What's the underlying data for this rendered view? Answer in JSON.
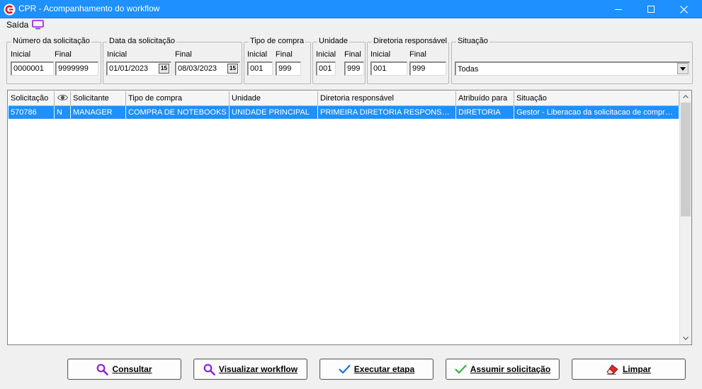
{
  "window": {
    "title": "CPR - Acompanhamento do workflow",
    "app_icon": "cpr-logo-icon",
    "controls": [
      "minimize-icon",
      "maximize-icon",
      "close-icon"
    ]
  },
  "menu": {
    "saida": "Saída",
    "screen_icon": "monitor-icon"
  },
  "filters": {
    "numero": {
      "legend": "Número da solicitação",
      "inicial_label": "Inicial",
      "final_label": "Final",
      "inicial": "0000001",
      "final": "9999999"
    },
    "data": {
      "legend": "Data da solicitação",
      "inicial_label": "Inicial",
      "final_label": "Final",
      "inicial": "01/01/2023",
      "final": "08/03/2023",
      "calendar_glyph": "15"
    },
    "tipo": {
      "legend": "Tipo de compra",
      "inicial_label": "Inicial",
      "final_label": "Final",
      "inicial": "001",
      "final": "999"
    },
    "unidade": {
      "legend": "Unidade",
      "inicial_label": "Inicial",
      "final_label": "Final",
      "inicial": "001",
      "final": "999"
    },
    "diretoria": {
      "legend": "Diretoria responsável",
      "inicial_label": "Inicial",
      "final_label": "Final",
      "inicial": "001",
      "final": "999"
    },
    "situacao": {
      "legend": "Situação",
      "selected": "Todas"
    }
  },
  "grid": {
    "columns": [
      "Solicitação",
      "",
      "Solicitante",
      "Tipo de compra",
      "Unidade",
      "Diretoria responsável",
      "Atribuído para",
      "Situação"
    ],
    "eye_icon": "eye-icon",
    "rows": [
      [
        "570786",
        "N",
        "MANAGER",
        "COMPRA DE NOTEBOOKS",
        "UNIDADE PRINCIPAL",
        "PRIMEIRA DIRETORIA RESPONSAVEL",
        "DIRETORIA",
        "Gestor - Liberacao da solicitacao de compra de notebooks"
      ]
    ]
  },
  "buttons": {
    "consultar": "Consultar",
    "visualizar": "Visualizar workflow",
    "executar": "Executar etapa",
    "assumir": "Assumir solicitação",
    "limpar": "Limpar"
  },
  "colors": {
    "titlebar": "#1e90ff",
    "selection": "#1e90ff",
    "accent_purple": "#8b1fd6",
    "accent_blue": "#1c6fd4",
    "accent_green": "#2fb34a",
    "accent_red": "#d92b2b"
  }
}
